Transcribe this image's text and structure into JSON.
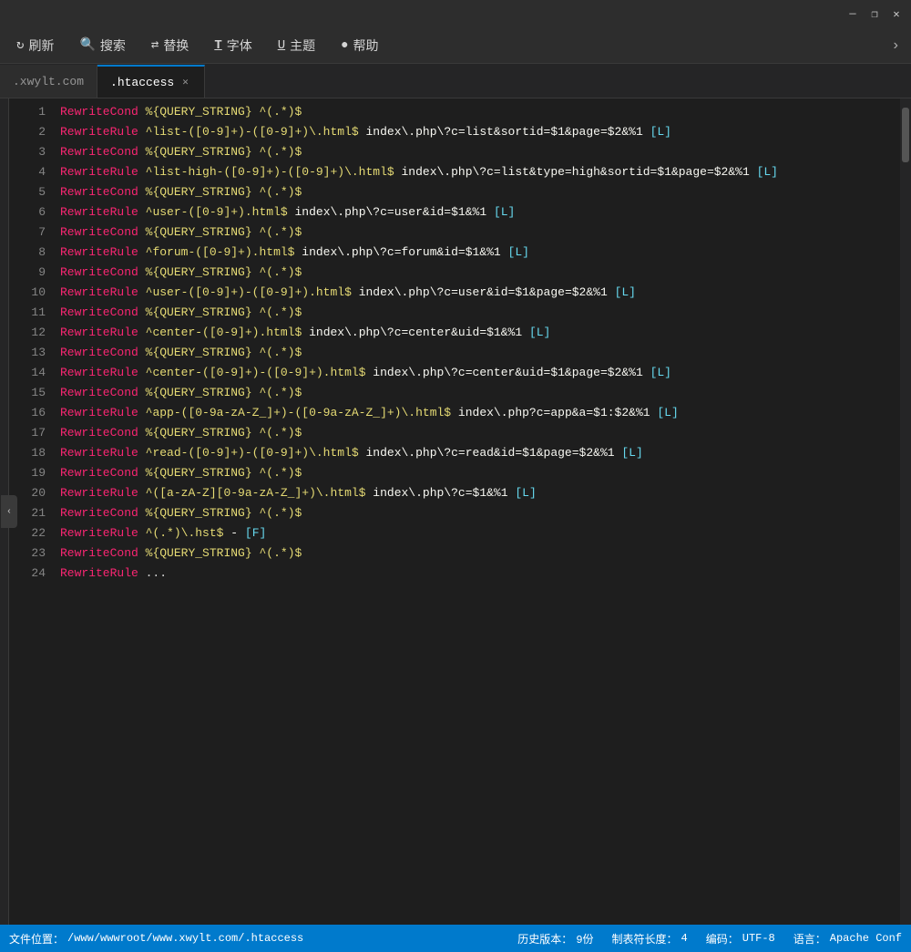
{
  "titlebar": {
    "minimize_label": "—",
    "restore_label": "❐",
    "close_label": "✕"
  },
  "menubar": {
    "items": [
      {
        "id": "refresh",
        "icon": "↻",
        "label": "刷新"
      },
      {
        "id": "search",
        "icon": "🔍",
        "label": "搜索"
      },
      {
        "id": "replace",
        "icon": "⇄",
        "label": "替换"
      },
      {
        "id": "font",
        "icon": "T",
        "label": "字体"
      },
      {
        "id": "theme",
        "icon": "U",
        "label": "主题"
      },
      {
        "id": "help",
        "icon": "❓",
        "label": "帮助"
      }
    ]
  },
  "tabs": [
    {
      "id": "site",
      "label": ".xwylt.com",
      "active": false,
      "closable": false
    },
    {
      "id": "htaccess",
      "label": ".htaccess",
      "active": true,
      "closable": true
    }
  ],
  "code": {
    "lines": [
      {
        "num": 1,
        "content": "RewriteCond %{QUERY_STRING} ^(.*)$"
      },
      {
        "num": 2,
        "content": "RewriteRule ^list-([0-9]+)-([0-9]+)\\.html$ index\\.php\\?c=list&sortid=$1&page=$2&%1 [L]"
      },
      {
        "num": 3,
        "content": "RewriteCond %{QUERY_STRING} ^(.*)$"
      },
      {
        "num": 4,
        "content": "RewriteRule ^list-high-([0-9]+)-([0-9]+)\\.html$ index\\.php\\?c=list&type=high&sortid=$1&page=$2&%1 [L]"
      },
      {
        "num": 5,
        "content": "RewriteCond %{QUERY_STRING} ^(.*)$"
      },
      {
        "num": 6,
        "content": "RewriteRule ^user-([0-9]+).html$ index\\.php\\?c=user&id=$1&%1 [L]"
      },
      {
        "num": 7,
        "content": "RewriteCond %{QUERY_STRING} ^(.*)$"
      },
      {
        "num": 8,
        "content": "RewriteRule ^forum-([0-9]+).html$ index\\.php\\?c=forum&id=$1&%1 [L]"
      },
      {
        "num": 9,
        "content": "RewriteCond %{QUERY_STRING} ^(.*)$"
      },
      {
        "num": 10,
        "content": "RewriteRule ^user-([0-9]+)-([0-9]+).html$ index\\.php\\?c=user&id=$1&page=$2&%1 [L]"
      },
      {
        "num": 11,
        "content": "RewriteCond %{QUERY_STRING} ^(.*)$"
      },
      {
        "num": 12,
        "content": "RewriteRule ^center-([0-9]+).html$ index\\.php\\?c=center&uid=$1&%1 [L]"
      },
      {
        "num": 13,
        "content": "RewriteCond %{QUERY_STRING} ^(.*)$"
      },
      {
        "num": 14,
        "content": "RewriteRule ^center-([0-9]+)-([0-9]+).html$ index\\.php\\?c=center&uid=$1&page=$2&%1 [L]"
      },
      {
        "num": 15,
        "content": "RewriteCond %{QUERY_STRING} ^(.*)$"
      },
      {
        "num": 16,
        "content": "RewriteRule ^app-([0-9a-zA-Z_]+)-([0-9a-zA-Z_]+)\\.html$ index\\.php?c=app&a=$1:$2&%1 [L]"
      },
      {
        "num": 17,
        "content": "RewriteCond %{QUERY_STRING} ^(.*)$"
      },
      {
        "num": 18,
        "content": "RewriteRule ^read-([0-9]+)-([0-9]+)\\.html$ index\\.php\\?c=read&id=$1&page=$2&%1 [L]"
      },
      {
        "num": 19,
        "content": "RewriteCond %{QUERY_STRING} ^(.*)$"
      },
      {
        "num": 20,
        "content": "RewriteRule ^([a-zA-Z][0-9a-zA-Z_]+)\\.html$ index\\.php\\?c=$1&%1 [L]"
      },
      {
        "num": 21,
        "content": "RewriteCond %{QUERY_STRING} ^(.*)$"
      },
      {
        "num": 22,
        "content": "RewriteRule ^(.*)\\.hst$ - [F]"
      },
      {
        "num": 23,
        "content": "RewriteCond %{QUERY_STRING} ^(.*)$"
      },
      {
        "num": 24,
        "content": "RewriteRule ..."
      }
    ]
  },
  "statusbar": {
    "file_path_label": "文件位置：",
    "file_path": "/www/wwwroot/www.xwylt.com/.htaccess",
    "history_label": "历史版本：",
    "history_count": "9份",
    "tab_label": "制表符长度：",
    "tab_size": "4",
    "encoding_label": "编码：",
    "encoding": "UTF-8",
    "language_label": "语言：",
    "language": "Apache Conf"
  }
}
